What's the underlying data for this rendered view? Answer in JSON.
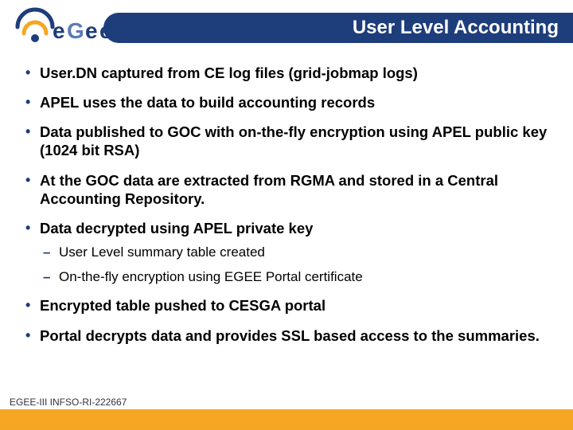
{
  "header": {
    "title": "User Level Accounting",
    "logo_alt": "egee-logo"
  },
  "bullets": [
    {
      "text": "User.DN captured from CE log files (grid-jobmap logs)"
    },
    {
      "text": "APEL uses the data to build accounting records"
    },
    {
      "text": "Data published to GOC with on-the-fly encryption using APEL public key (1024 bit RSA)"
    },
    {
      "text": "At the GOC data are extracted from RGMA and stored in a Central Accounting Repository."
    },
    {
      "text": "Data decrypted using APEL private key",
      "sub": [
        "User Level summary table created",
        "On-the-fly encryption using EGEE Portal certificate"
      ]
    },
    {
      "text": "Encrypted table pushed to CESGA portal"
    },
    {
      "text": "Portal decrypts data and provides SSL based access to the summaries."
    }
  ],
  "footer": {
    "text": "EGEE-III INFSO-RI-222667"
  }
}
